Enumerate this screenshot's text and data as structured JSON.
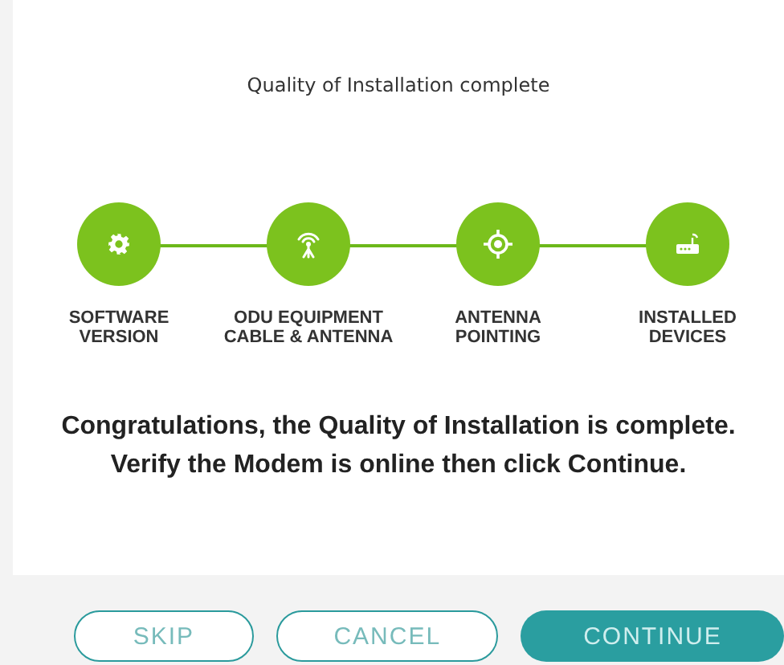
{
  "title": "Quality of Installation complete",
  "steps": [
    {
      "kind": "gear",
      "label": [
        "SOFTWARE",
        "VERSION"
      ]
    },
    {
      "kind": "antenna",
      "label": [
        "ODU EQUIPMENT",
        "CABLE & ANTENNA"
      ]
    },
    {
      "kind": "target",
      "label": [
        "ANTENNA",
        "POINTING"
      ]
    },
    {
      "kind": "router",
      "label": [
        "INSTALLED",
        "DEVICES"
      ]
    }
  ],
  "message": [
    "Congratulations, the Quality of Installation is complete.",
    "Verify the Modem is online then click Continue."
  ],
  "buttons": [
    {
      "label": "SKIP",
      "kind": "outline"
    },
    {
      "label": "CANCEL",
      "kind": "outline"
    },
    {
      "label": "CONTINUE",
      "kind": "filled"
    }
  ]
}
